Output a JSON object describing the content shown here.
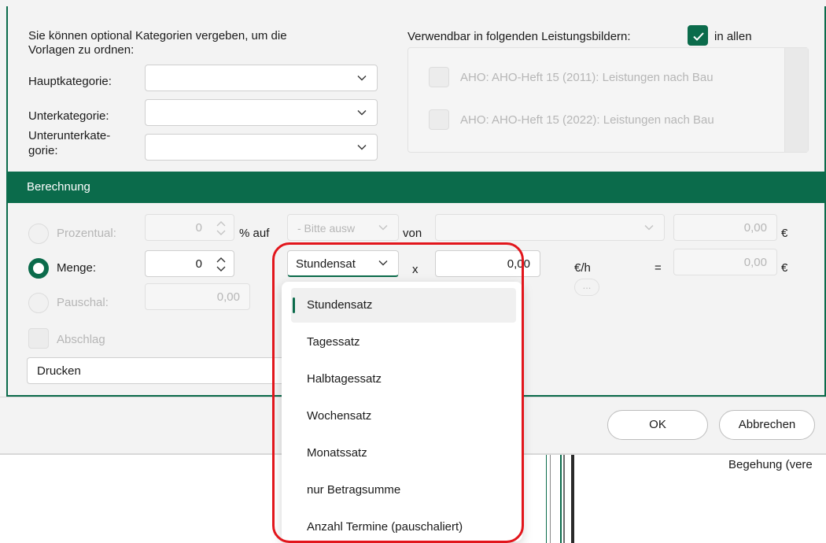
{
  "categories": {
    "intro": "Sie können optional Kategorien vergeben, um die",
    "intro2": "Vorlagen zu ordnen:",
    "main_label": "Hauptkategorie:",
    "sub_label": "Unterkategorie:",
    "subsub_label_1": "Unterunterkate-",
    "subsub_label_2": "gorie:",
    "main_value": "",
    "sub_value": "",
    "subsub_value": ""
  },
  "usage": {
    "label": "Verwendbar in folgenden Leistungsbildern:",
    "all_label": "in allen",
    "all_checked": true,
    "items": [
      {
        "label": "AHO: AHO-Heft 15 (2011): Leistungen nach Bau",
        "checked": false
      },
      {
        "label": "AHO: AHO-Heft 15 (2022): Leistungen nach Bau",
        "checked": false
      }
    ]
  },
  "calc": {
    "section_title": "Berechnung",
    "prozentual_label": "Prozentual:",
    "prozentual_value": "0",
    "percent_on_label": "% auf",
    "percent_basis_placeholder": "- Bitte ausw",
    "von_label": "von",
    "von_value": "",
    "prozentual_result": "0,00",
    "currency": "€",
    "menge_label": "Menge:",
    "menge_value": "0",
    "rate_type": "Stundensat",
    "times": "x",
    "rate_value": "0,00",
    "rate_unit": "€/h",
    "equals": "=",
    "menge_result": "0,00",
    "pauschal_label": "Pauschal:",
    "pauschal_value": "0,00",
    "abschlag_label": "Abschlag",
    "print_value": "Drucken",
    "ellipsis": "..."
  },
  "buttons": {
    "ok": "OK",
    "cancel": "Abbrechen"
  },
  "dropdown": {
    "selected_index": 0,
    "options": [
      "Stundensatz",
      "Tagessatz",
      "Halbtagessatz",
      "Wochensatz",
      "Monatssatz",
      "nur Betragsumme",
      "Anzahl Termine (pauschaliert)"
    ]
  },
  "background": {
    "partial_text": "Begehung (vere"
  },
  "colors": {
    "accent": "#0b6b4b",
    "highlight": "#e2161c"
  }
}
